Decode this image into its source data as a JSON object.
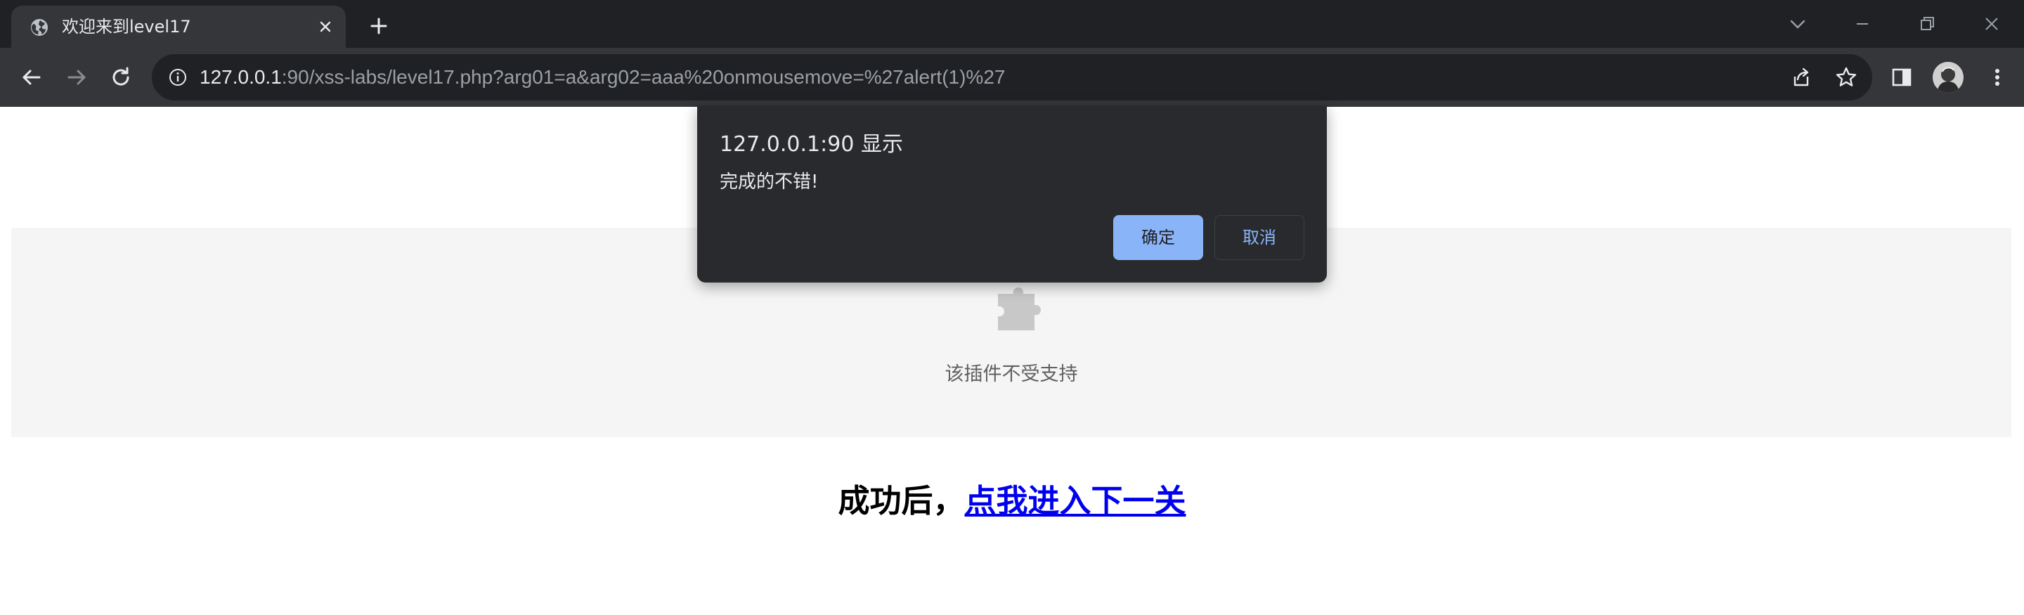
{
  "browser": {
    "tab": {
      "title": "欢迎来到level17",
      "favicon": "globe-icon",
      "close_icon": "close-icon"
    },
    "new_tab_icon": "plus-icon",
    "window_controls": [
      "chevron-down-icon",
      "minimize-icon",
      "restore-icon",
      "close-icon"
    ],
    "toolbar": {
      "back_icon": "arrow-left-icon",
      "forward_icon": "arrow-right-icon",
      "reload_icon": "reload-icon",
      "address": {
        "host": "127.0.0.1",
        "rest": ":90/xss-labs/level17.php?arg01=a&arg02=aaa%20onmousemove=%27alert(1)%27"
      },
      "right_icons": [
        "share-icon",
        "star-icon",
        "side-panel-icon",
        "avatar",
        "more-vert-icon"
      ]
    }
  },
  "page": {
    "plugin_message": "该插件不受支持",
    "plugin_icon": "puzzle-icon",
    "success_prefix": "成功后，",
    "next_level_link": "点我进入下一关"
  },
  "dialog": {
    "title": "127.0.0.1:90 显示",
    "message": "完成的不错!",
    "ok_label": "确定",
    "cancel_label": "取消"
  },
  "colors": {
    "tabstrip_bg": "#202124",
    "toolbar_bg": "#35363a",
    "dialog_bg": "#292a2d",
    "accent": "#8ab4f8",
    "link": "#0000ee"
  }
}
